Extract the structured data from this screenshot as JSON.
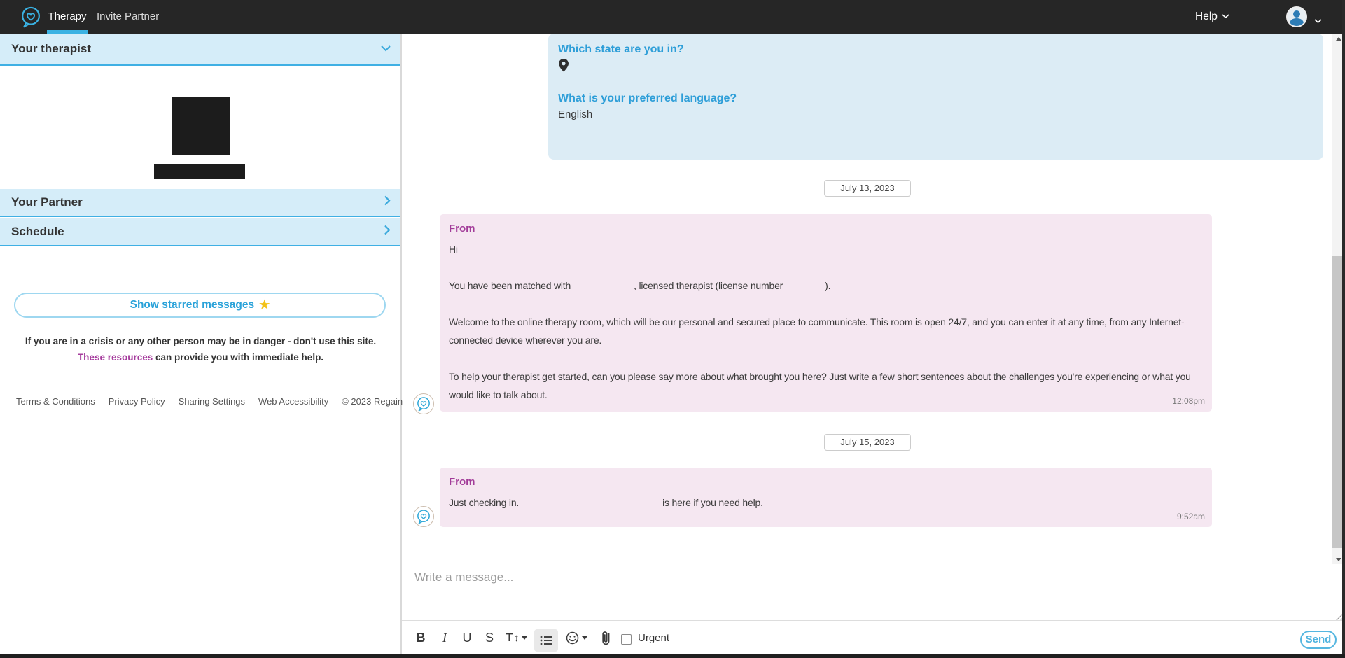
{
  "nav": {
    "tabs": [
      {
        "label": "Therapy",
        "active": true
      },
      {
        "label": "Invite Partner",
        "active": false
      }
    ],
    "help_label": "Help"
  },
  "icons": {
    "star": "★",
    "updown_arrow": "↕"
  },
  "sidebar": {
    "therapist_header": "Your therapist",
    "partner_header": "Your Partner",
    "schedule_header": "Schedule",
    "starred_button": "Show starred messages",
    "crisis": {
      "before_link": "If you are in a crisis or any other person may be in danger - don't use this site.",
      "link": "These resources",
      "after_link": "can provide you with immediate help."
    },
    "footer_links": [
      "Terms & Conditions",
      "Privacy Policy",
      "Sharing Settings",
      "Web Accessibility"
    ],
    "copyright": "© 2023 Regain"
  },
  "chat": {
    "intake_card": {
      "question1": "Which state are you in?",
      "question2": "What is your preferred language?",
      "answer2": "English"
    },
    "date1": "July 13, 2023",
    "message1": {
      "from_label": "From",
      "greeting": "Hi",
      "matched_before": "You have been matched with",
      "matched_mid": ", licensed therapist (license number",
      "matched_end": ").",
      "para_welcome": "Welcome to the online therapy room, which will be our personal and secured place to communicate. This room is open 24/7, and you can enter it at any time, from any Internet-connected device wherever you are.",
      "para_help": "To help your therapist get started, can you please say more about what brought you here? Just write a few short sentences about the challenges you're experiencing or what you would like to talk about.",
      "time": "12:08pm"
    },
    "date2": "July 15, 2023",
    "message2": {
      "from_label": "From",
      "part1": "Just checking in.",
      "part2": "is here if you need help.",
      "time": "9:52am"
    },
    "composer": {
      "placeholder": "Write a message...",
      "toolbar": {
        "bold": "B",
        "italic": "I",
        "underline": "U",
        "strikethrough": "S",
        "textsize": "T"
      },
      "urgent_label": "Urgent",
      "send_label": "Send"
    }
  },
  "colors": {
    "accent_blue": "#3ab2e3",
    "section_bg": "#d5edf9",
    "intake_card_bg": "#dcecf5",
    "message_card_bg": "#f5e7f1",
    "from_magenta": "#a23c99",
    "crisis_link_purple": "#a53c9d",
    "question_blue": "#2d9ed8",
    "navbar_bg": "#262626"
  }
}
